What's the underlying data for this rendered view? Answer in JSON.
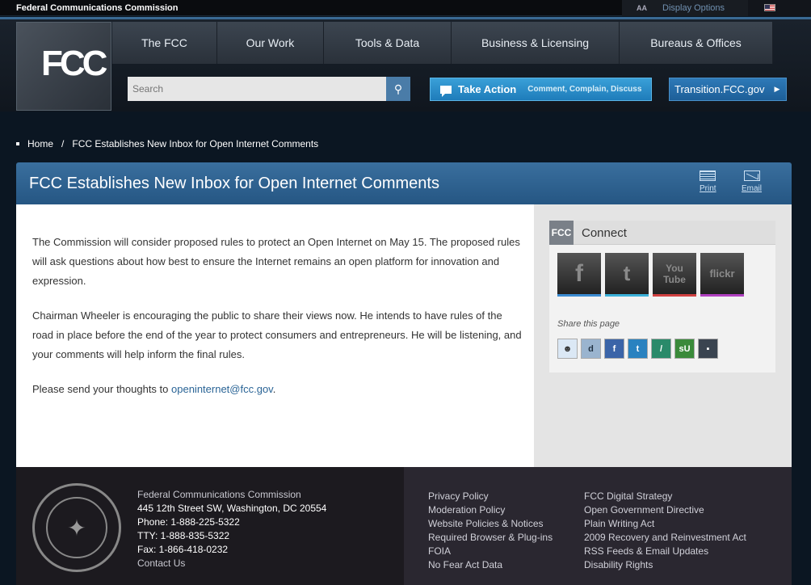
{
  "utility": {
    "site_title": "Federal Communications Commission",
    "font_toggle": "AA",
    "display_options": "Display Options"
  },
  "header": {
    "logo_text": "FCC",
    "nav": [
      "The FCC",
      "Our Work",
      "Tools & Data",
      "Business & Licensing",
      "Bureaus & Offices"
    ],
    "search_placeholder": "Search",
    "take_action": {
      "label": "Take Action",
      "sub": "Comment, Complain, Discuss"
    },
    "transition": {
      "label": "Transition.FCC.gov",
      "arrow": "▶"
    }
  },
  "breadcrumb": {
    "home": "Home",
    "separator": "/",
    "current": "FCC Establishes New Inbox for Open Internet Comments"
  },
  "article": {
    "title": "FCC Establishes New Inbox for Open Internet Comments",
    "print": "Print",
    "email": "Email",
    "p1": "The Commission will consider proposed rules to protect an Open Internet on May 15. The proposed rules will ask questions about how best to ensure the Internet remains an open platform for innovation and expression.",
    "p2": "Chairman Wheeler is encouraging the public to share their views now. He intends to have rules of the road in place before the end of the year to protect consumers and entrepreneurs. He will be listening, and your comments will help inform the final rules.",
    "p3_prefix": "Please send your thoughts to ",
    "p3_link": "openinternet@fcc.gov",
    "p3_suffix": "."
  },
  "sidebar": {
    "connect_logo": "FCC",
    "connect_title": "Connect",
    "social": {
      "facebook": "f",
      "twitter": "t",
      "youtube_1": "You",
      "youtube_2": "Tube",
      "flickr": "flickr"
    },
    "share_label": "Share this page",
    "share_glyphs": {
      "reddit": "☻",
      "digg": "d",
      "facebook": "f",
      "twitter": "t",
      "delicious": "/",
      "stumbleupon": "sU",
      "del": "▪"
    }
  },
  "footer": {
    "seal_glyph": "✦",
    "org": "Federal Communications Commission",
    "address": "445 12th Street SW, Washington, DC 20554",
    "phone": "Phone: 1-888-225-5322",
    "tty": "TTY: 1-888-835-5322",
    "fax": "Fax: 1-866-418-0232",
    "contact": "Contact Us",
    "col1": [
      "Privacy Policy",
      "Moderation Policy",
      "Website Policies & Notices",
      "Required Browser & Plug-ins",
      "FOIA",
      "No Fear Act Data"
    ],
    "col2": [
      "FCC Digital Strategy",
      "Open Government Directive",
      "Plain Writing Act",
      "2009 Recovery and Reinvestment Act",
      "RSS Feeds & Email Updates",
      "Disability Rights"
    ]
  },
  "colors": {
    "accent_blue": "#255683",
    "action_blue": "#1e7cba",
    "link_blue": "#2a6496"
  }
}
